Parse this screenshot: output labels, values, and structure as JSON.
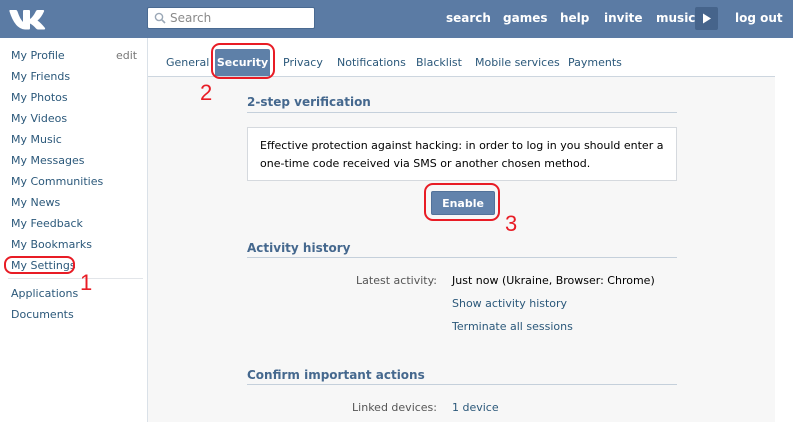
{
  "topbar": {
    "logo_icon": "vk-logo-icon",
    "search_placeholder": "Search",
    "nav": [
      "search",
      "games",
      "help",
      "invite",
      "music"
    ],
    "play_icon": "play-icon",
    "logout": "log out",
    "colors": {
      "bar": "#5b7ba4",
      "button": "#46648b"
    }
  },
  "sidebar": {
    "items": [
      "My Profile",
      "My Friends",
      "My Photos",
      "My Videos",
      "My Music",
      "My Messages",
      "My Communities",
      "My News",
      "My Feedback",
      "My Bookmarks",
      "My Settings"
    ],
    "edit_label": "edit",
    "extra_items": [
      "Applications",
      "Documents"
    ]
  },
  "tabs": {
    "items": [
      "General",
      "Security",
      "Privacy",
      "Notifications",
      "Blacklist",
      "Mobile services",
      "Payments"
    ],
    "active": "Security"
  },
  "two_step": {
    "title": "2-step verification",
    "description": "Effective protection against hacking: in order to log in you should enter a one-time code received via SMS or another chosen method.",
    "button": "Enable"
  },
  "activity": {
    "title": "Activity history",
    "latest_label": "Latest activity:",
    "latest_value": "Just now (Ukraine, Browser: Chrome)",
    "show_link": "Show activity history",
    "terminate_link": "Terminate all sessions"
  },
  "confirm": {
    "title": "Confirm important actions",
    "linked_label": "Linked devices:",
    "linked_value": "1 device"
  },
  "annotations": {
    "marker_1": "1",
    "marker_2": "2",
    "marker_3": "3",
    "color": "#e81c25"
  }
}
